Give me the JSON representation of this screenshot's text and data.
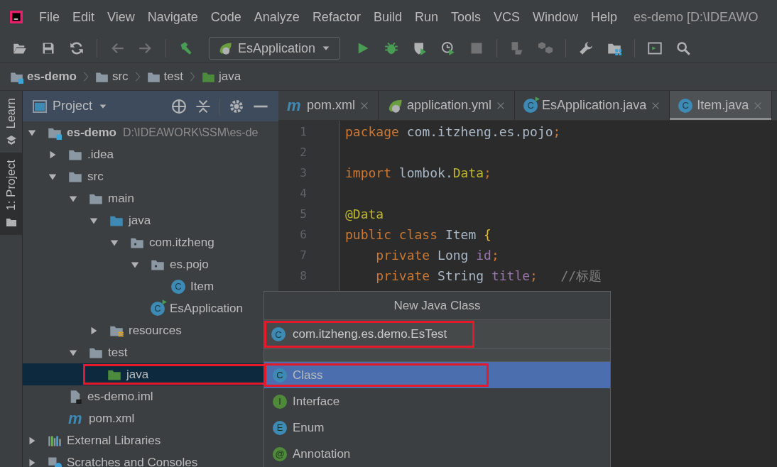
{
  "menu": {
    "items": [
      "File",
      "Edit",
      "View",
      "Navigate",
      "Code",
      "Analyze",
      "Refactor",
      "Build",
      "Run",
      "Tools",
      "VCS",
      "Window",
      "Help"
    ],
    "title": "es-demo [D:\\IDEAWO"
  },
  "toolbar": [
    {
      "kind": "open-folder",
      "disabled": false
    },
    {
      "kind": "save",
      "disabled": false
    },
    {
      "kind": "sync",
      "disabled": false
    },
    {
      "kind": "separator"
    },
    {
      "kind": "arrow-left",
      "disabled": true
    },
    {
      "kind": "arrow-right",
      "disabled": true
    },
    {
      "kind": "separator"
    },
    {
      "kind": "hammer",
      "disabled": false
    },
    {
      "kind": "run-config",
      "label": "EsApplication"
    },
    {
      "kind": "play",
      "disabled": false
    },
    {
      "kind": "bug",
      "disabled": false
    },
    {
      "kind": "shield",
      "disabled": false
    },
    {
      "kind": "clock",
      "disabled": false
    },
    {
      "kind": "stop",
      "disabled": true
    },
    {
      "kind": "separator"
    },
    {
      "kind": "attach",
      "disabled": true
    },
    {
      "kind": "cubes",
      "disabled": true
    },
    {
      "kind": "separator"
    },
    {
      "kind": "wrench",
      "disabled": false
    },
    {
      "kind": "folder-grid",
      "disabled": false
    },
    {
      "kind": "separator"
    },
    {
      "kind": "terminal",
      "disabled": false
    },
    {
      "kind": "search",
      "disabled": false
    }
  ],
  "breadcrumb": [
    {
      "label": "es-demo",
      "kind": "module"
    },
    {
      "label": "src",
      "kind": "folder"
    },
    {
      "label": "test",
      "kind": "folder"
    },
    {
      "label": "java",
      "kind": "test-folder"
    }
  ],
  "side_tabs": [
    {
      "label": "Learn",
      "kind": "learn",
      "selected": false
    },
    {
      "label": "1: Project",
      "kind": "project",
      "selected": true
    }
  ],
  "project_panel": {
    "title": "Project",
    "tree": [
      {
        "label": "es-demo",
        "hint": "D:\\IDEAWORK\\SSM\\es-de",
        "kind": "module",
        "expanded": true,
        "selected": false,
        "highlighted": false,
        "children": [
          {
            "label": ".idea",
            "kind": "folder",
            "expanded": false,
            "selected": false,
            "highlighted": false
          },
          {
            "label": "src",
            "kind": "folder",
            "expanded": true,
            "selected": false,
            "highlighted": false,
            "children": [
              {
                "label": "main",
                "kind": "folder",
                "expanded": true,
                "selected": false,
                "highlighted": false,
                "children": [
                  {
                    "label": "java",
                    "kind": "source-folder",
                    "expanded": true,
                    "selected": false,
                    "highlighted": false,
                    "children": [
                      {
                        "label": "com.itzheng",
                        "kind": "package",
                        "expanded": true,
                        "selected": false,
                        "highlighted": false,
                        "children": [
                          {
                            "label": "es.pojo",
                            "kind": "package",
                            "expanded": true,
                            "selected": false,
                            "highlighted": false,
                            "children": [
                              {
                                "label": "Item",
                                "kind": "class",
                                "badge": "C",
                                "selected": false,
                                "highlighted": false
                              }
                            ]
                          },
                          {
                            "label": "EsApplication",
                            "kind": "spring-class",
                            "badge": "C",
                            "selected": false,
                            "highlighted": false
                          }
                        ]
                      }
                    ]
                  },
                  {
                    "label": "resources",
                    "kind": "resources",
                    "expanded": false,
                    "selected": false,
                    "highlighted": false
                  }
                ]
              },
              {
                "label": "test",
                "kind": "folder",
                "expanded": true,
                "selected": false,
                "highlighted": false,
                "children": [
                  {
                    "label": "java",
                    "kind": "test-folder",
                    "selected": true,
                    "highlighted": true
                  }
                ]
              }
            ]
          },
          {
            "label": "es-demo.iml",
            "kind": "iml",
            "selected": false,
            "highlighted": false
          },
          {
            "label": "pom.xml",
            "kind": "maven",
            "badge": "m",
            "selected": false,
            "highlighted": false
          }
        ]
      },
      {
        "label": "External Libraries",
        "kind": "libraries",
        "expanded": false,
        "selected": false,
        "highlighted": false
      },
      {
        "label": "Scratches and Consoles",
        "kind": "scratches",
        "expanded": false,
        "selected": false,
        "highlighted": false
      }
    ]
  },
  "editor": {
    "tabs": [
      {
        "label": "pom.xml",
        "kind": "maven",
        "badge": "m",
        "selected": false
      },
      {
        "label": "application.yml",
        "kind": "spring-config",
        "selected": false
      },
      {
        "label": "EsApplication.java",
        "kind": "spring-class",
        "badge": "C",
        "selected": false
      },
      {
        "label": "Item.java",
        "kind": "class",
        "badge": "C",
        "selected": true
      }
    ],
    "lines": [
      {
        "number": "1",
        "tokens": [
          {
            "kind": "keyword",
            "text": "package "
          },
          {
            "kind": "plain",
            "text": "com.itzheng.es.pojo"
          },
          {
            "kind": "keyword",
            "text": ";"
          }
        ]
      },
      {
        "number": "2"
      },
      {
        "number": "3",
        "tokens": [
          {
            "kind": "keyword",
            "text": "import "
          },
          {
            "kind": "plain",
            "text": "lombok."
          },
          {
            "kind": "annotation",
            "text": "Data"
          },
          {
            "kind": "keyword",
            "text": ";"
          }
        ]
      },
      {
        "number": "4"
      },
      {
        "number": "5",
        "tokens": [
          {
            "kind": "annotation",
            "text": "@Data"
          }
        ]
      },
      {
        "number": "6",
        "tokens": [
          {
            "kind": "keyword",
            "text": "public class "
          },
          {
            "kind": "plain",
            "text": "Item "
          },
          {
            "kind": "brace",
            "text": "{"
          }
        ]
      },
      {
        "number": "7",
        "tokens": [
          {
            "kind": "keyword",
            "text": "    private "
          },
          {
            "kind": "plain",
            "text": "Long "
          },
          {
            "kind": "field",
            "text": "id"
          },
          {
            "kind": "keyword",
            "text": ";"
          }
        ]
      },
      {
        "number": "8",
        "tokens": [
          {
            "kind": "keyword",
            "text": "    private "
          },
          {
            "kind": "plain",
            "text": "String "
          },
          {
            "kind": "field",
            "text": "title"
          },
          {
            "kind": "keyword",
            "text": ";   "
          },
          {
            "kind": "comment",
            "text": "//标题"
          }
        ]
      }
    ]
  },
  "dialog": {
    "title": "New Java Class",
    "field": {
      "badge": "C",
      "value": "com.itzheng.es.demo.EsTest",
      "highlighted": true
    },
    "options": [
      {
        "label": "Class",
        "badge": "C",
        "color": "#3d8ab4",
        "selected": true,
        "highlighted": true
      },
      {
        "label": "Interface",
        "badge": "I",
        "color": "#4f8a3a",
        "selected": false,
        "highlighted": false
      },
      {
        "label": "Enum",
        "badge": "E",
        "color": "#3d8ab4",
        "selected": false,
        "highlighted": false
      },
      {
        "label": "Annotation",
        "badge": "@",
        "color": "#4f8a3a",
        "selected": false,
        "highlighted": false
      }
    ]
  }
}
